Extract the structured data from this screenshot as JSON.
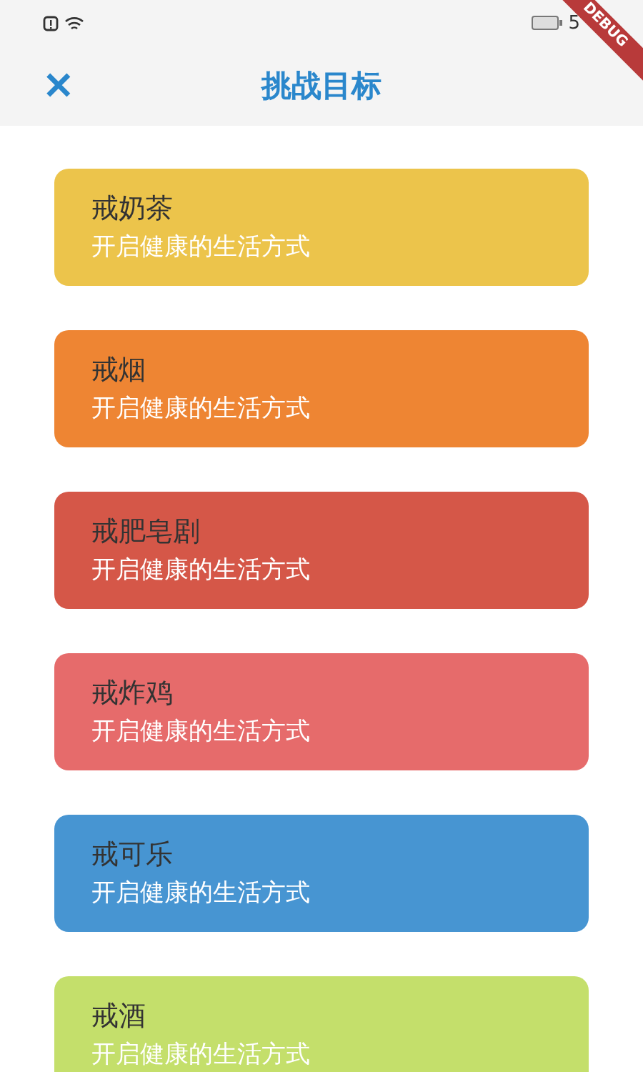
{
  "status_bar": {
    "time": "5"
  },
  "debug_banner": "DEBUG",
  "header": {
    "title": "挑战目标",
    "close": "✕"
  },
  "goals": [
    {
      "title": "戒奶茶",
      "subtitle": "开启健康的生活方式",
      "color": "#ecc44b"
    },
    {
      "title": "戒烟",
      "subtitle": "开启健康的生活方式",
      "color": "#ee8533"
    },
    {
      "title": "戒肥皂剧",
      "subtitle": "开启健康的生活方式",
      "color": "#d55748"
    },
    {
      "title": "戒炸鸡",
      "subtitle": "开启健康的生活方式",
      "color": "#e66b6b"
    },
    {
      "title": "戒可乐",
      "subtitle": "开启健康的生活方式",
      "color": "#4795d2"
    },
    {
      "title": "戒酒",
      "subtitle": "开启健康的生活方式",
      "color": "#c4df6b"
    }
  ]
}
